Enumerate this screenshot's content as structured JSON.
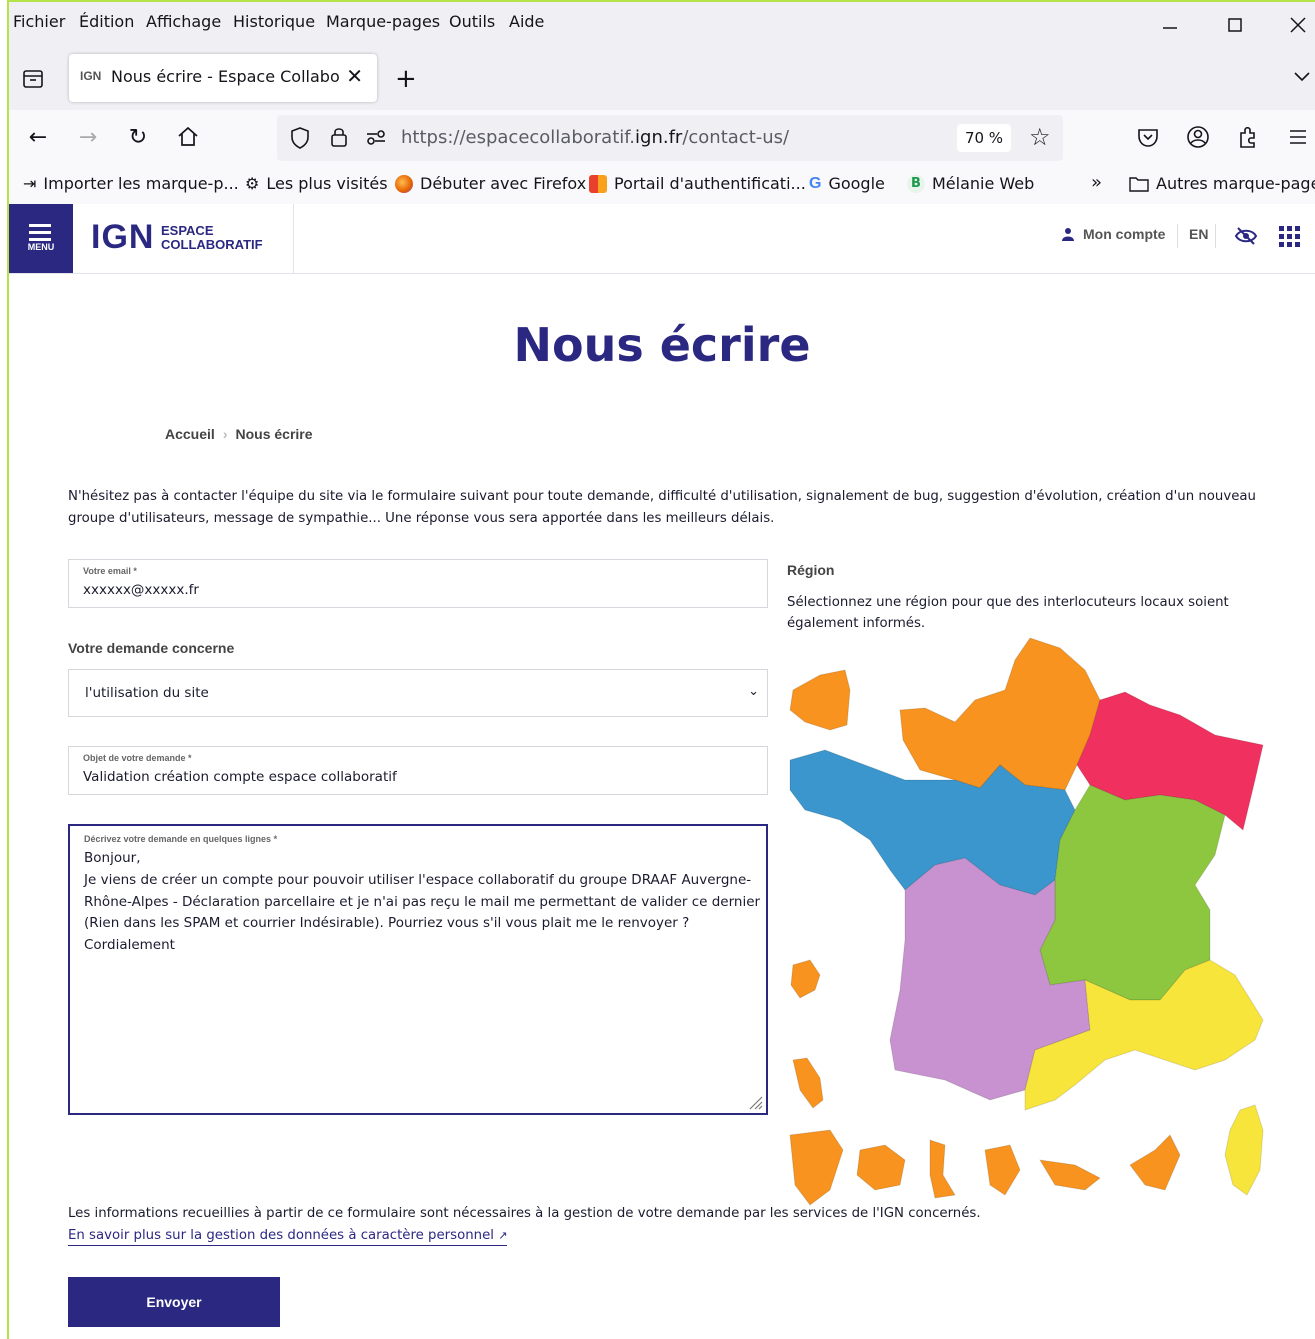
{
  "menubar": {
    "items": [
      "Fichier",
      "Édition",
      "Affichage",
      "Historique",
      "Marque-pages",
      "Outils",
      "Aide"
    ]
  },
  "tab": {
    "favicon": "IGN",
    "title": "Nous écrire - Espace Collaborati"
  },
  "navbar": {
    "url_prefix": "https://espacecollaboratif.",
    "url_domain": "ign.fr",
    "url_suffix": "/contact-us/",
    "zoom": "70 %"
  },
  "bookmarks": [
    {
      "label": "Importer les marque-p...",
      "icon": "import-icon"
    },
    {
      "label": "Les plus visités",
      "icon": "gear-icon"
    },
    {
      "label": "Débuter avec Firefox",
      "icon": "firefox-icon"
    },
    {
      "label": "Portail d'authentificati...",
      "icon": "portal-icon"
    },
    {
      "label": "Google",
      "icon": "google-icon"
    },
    {
      "label": "Mélanie Web",
      "icon": "melanie-icon"
    },
    {
      "label": "Autres marque-pages",
      "icon": "folder-icon"
    }
  ],
  "header": {
    "menu_label": "MENU",
    "logo_main": "IGN",
    "logo_sub1": "ESPACE",
    "logo_sub2": "COLLABORATIF",
    "account": "Mon compte",
    "lang": "EN"
  },
  "page": {
    "title": "Nous écrire",
    "breadcrumb_home": "Accueil",
    "breadcrumb_current": "Nous écrire",
    "intro": "N'hésitez pas à contacter l'équipe du site via le formulaire suivant pour toute demande, difficulté d'utilisation, signalement de bug, suggestion d'évolution, création d'un nouveau groupe d'utilisateurs, message de sympathie... Une réponse vous sera apportée dans les meilleurs délais."
  },
  "form": {
    "email_label": "Votre email *",
    "email_value": "xxxxxx@xxxxx.fr",
    "concern_label": "Votre demande concerne",
    "concern_value": "l'utilisation du site",
    "subject_label": "Objet de votre demande *",
    "subject_value": "Validation création compte espace collaboratif",
    "message_label": "Décrivez votre demande en quelques lignes *",
    "message_lines": [
      "Bonjour,",
      "Je viens de créer un compte pour pouvoir utiliser l'espace collaboratif du groupe DRAAF Auvergne-",
      "Rhône-Alpes - Déclaration parcellaire et je n'ai pas reçu le mail me permettant de valider ce dernier",
      "(Rien dans les SPAM et courrier Indésirable). Pourriez vous s'il vous plait me le renvoyer ?",
      "Cordialement"
    ],
    "legal_text": "Les informations recueillies à partir de ce formulaire sont nécessaires à la gestion de votre demande par les services de l'IGN concernés.",
    "legal_link": "En savoir plus sur la gestion des données à caractère personnel",
    "submit": "Envoyer"
  },
  "region": {
    "title": "Région",
    "description": "Sélectionnez une région pour que des interlocuteurs locaux soient également informés.",
    "colors": {
      "orange": "#f7931e",
      "pink": "#f0305e",
      "blue": "#3a96cd",
      "green": "#8dc63f",
      "purple": "#c792cf",
      "yellow": "#f7e53b"
    }
  }
}
